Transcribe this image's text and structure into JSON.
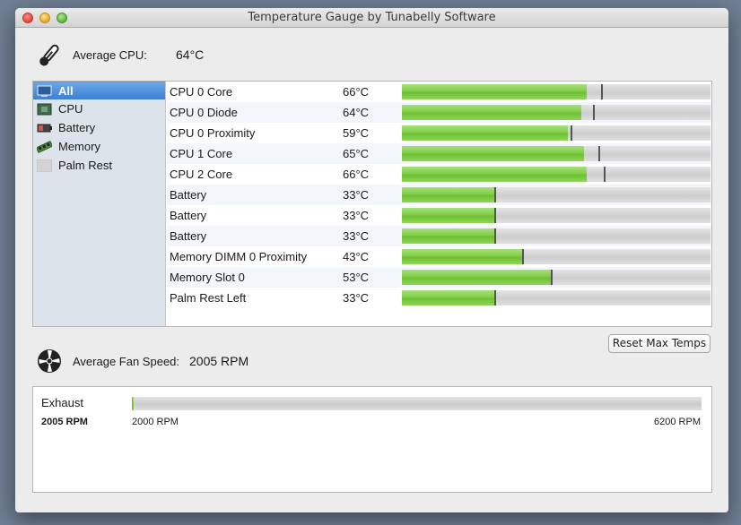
{
  "window": {
    "title": "Temperature Gauge by Tunabelly Software"
  },
  "avg_cpu": {
    "label": "Average CPU:",
    "value": "64°C",
    "icon": "thermometer-icon"
  },
  "sidebar": {
    "items": [
      {
        "label": "All",
        "icon": "monitor-icon",
        "selected": true
      },
      {
        "label": "CPU",
        "icon": "cpu-chip-icon",
        "selected": false
      },
      {
        "label": "Battery",
        "icon": "battery-icon",
        "selected": false
      },
      {
        "label": "Memory",
        "icon": "memory-module-icon",
        "selected": false
      },
      {
        "label": "Palm Rest",
        "icon": "palm-rest-icon",
        "selected": false
      }
    ]
  },
  "sensors": [
    {
      "name": "CPU 0 Core",
      "temp": "66°C",
      "value": 66,
      "max": 71
    },
    {
      "name": "CPU 0 Diode",
      "temp": "64°C",
      "value": 64,
      "max": 68
    },
    {
      "name": "CPU 0 Proximity",
      "temp": "59°C",
      "value": 59,
      "max": 60
    },
    {
      "name": "CPU 1 Core",
      "temp": "65°C",
      "value": 65,
      "max": 70
    },
    {
      "name": "CPU 2 Core",
      "temp": "66°C",
      "value": 66,
      "max": 72
    },
    {
      "name": "Battery",
      "temp": "33°C",
      "value": 33,
      "max": 33
    },
    {
      "name": "Battery",
      "temp": "33°C",
      "value": 33,
      "max": 33
    },
    {
      "name": "Battery",
      "temp": "33°C",
      "value": 33,
      "max": 33
    },
    {
      "name": "Memory DIMM 0 Proximity",
      "temp": "43°C",
      "value": 43,
      "max": 43
    },
    {
      "name": "Memory Slot 0",
      "temp": "53°C",
      "value": 53,
      "max": 53
    },
    {
      "name": "Palm Rest Left",
      "temp": "33°C",
      "value": 33,
      "max": 33
    }
  ],
  "gauge_scale": {
    "min": 0,
    "max": 110
  },
  "reset_button": {
    "label": "Reset Max Temps"
  },
  "avg_fan": {
    "label": "Average Fan Speed:",
    "value": "2005 RPM",
    "icon": "fan-icon"
  },
  "fans": [
    {
      "name": "Exhaust",
      "rpm": "2005 RPM",
      "value": 2005,
      "min_label": "2000 RPM",
      "max_label": "6200 RPM",
      "min": 2000,
      "max": 6200
    }
  ],
  "colors": {
    "bar_fill": "#7ccc42",
    "selection": "#3c7fd2"
  }
}
